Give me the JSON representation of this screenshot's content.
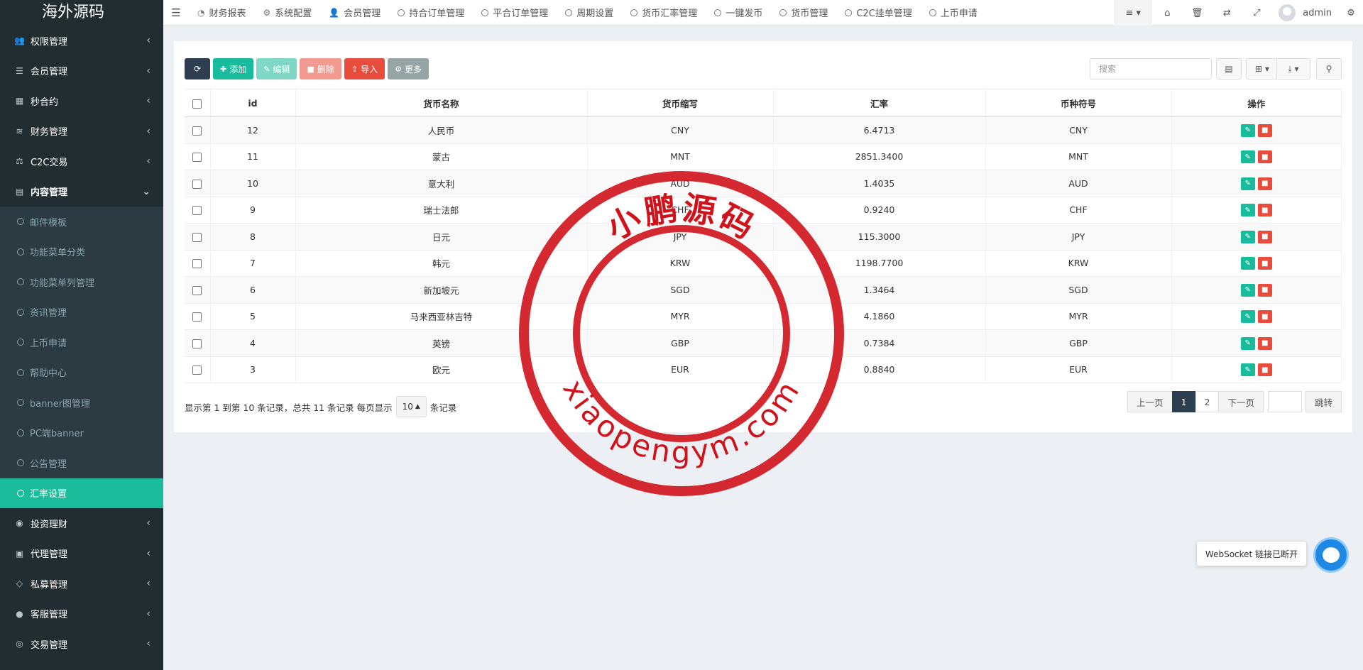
{
  "sidebar": {
    "logo": "海外源码",
    "items": [
      {
        "label": "权限管理",
        "icon": "users-icon",
        "ch": "‹"
      },
      {
        "label": "会员管理",
        "icon": "list-icon",
        "ch": "‹"
      },
      {
        "label": "秒合约",
        "icon": "calendar-icon",
        "ch": "‹"
      },
      {
        "label": "财务管理",
        "icon": "database-icon",
        "ch": "‹"
      },
      {
        "label": "C2C交易",
        "icon": "balance-icon",
        "ch": "‹"
      },
      {
        "label": "内容管理",
        "icon": "file-text-icon",
        "ch": "⌄"
      }
    ],
    "sub": [
      {
        "label": "邮件模板"
      },
      {
        "label": "功能菜单分类"
      },
      {
        "label": "功能菜单列管理"
      },
      {
        "label": "资讯管理"
      },
      {
        "label": "上币申请"
      },
      {
        "label": "帮助中心"
      },
      {
        "label": "banner图管理"
      },
      {
        "label": "PC端banner"
      },
      {
        "label": "公告管理"
      },
      {
        "label": "汇率设置"
      }
    ],
    "after": [
      {
        "label": "投资理财",
        "icon": "compass-icon",
        "ch": "‹"
      },
      {
        "label": "代理管理",
        "icon": "briefcase-icon",
        "ch": "‹"
      },
      {
        "label": "私募管理",
        "icon": "diamond-icon",
        "ch": "‹"
      },
      {
        "label": "客服管理",
        "icon": "comment-icon",
        "ch": "‹"
      },
      {
        "label": "交易管理",
        "icon": "eye-icon",
        "ch": "‹"
      }
    ]
  },
  "topbar": {
    "tabs": [
      {
        "label": "财务报表",
        "icon": "dashboard-icon"
      },
      {
        "label": "系统配置",
        "icon": "gear-icon"
      },
      {
        "label": "会员管理",
        "icon": "user-icon"
      },
      {
        "label": "持合订单管理",
        "icon": "circle-icon"
      },
      {
        "label": "平合订单管理",
        "icon": "circle-icon"
      },
      {
        "label": "周期设置",
        "icon": "circle-icon"
      },
      {
        "label": "货币汇率管理",
        "icon": "circle-icon"
      },
      {
        "label": "一键发币",
        "icon": "circle-icon"
      },
      {
        "label": "货币管理",
        "icon": "circle-icon"
      },
      {
        "label": "C2C挂单管理",
        "icon": "circle-icon"
      },
      {
        "label": "上币申请",
        "icon": "circle-icon"
      }
    ],
    "user": "admin"
  },
  "toolbar": {
    "add": "添加",
    "edit": "编辑",
    "delete": "删除",
    "import": "导入",
    "more": "更多"
  },
  "search": {
    "placeholder": "搜索"
  },
  "table": {
    "headers": [
      "id",
      "货币名称",
      "货币缩写",
      "汇率",
      "币种符号",
      "操作"
    ],
    "rows": [
      {
        "id": "12",
        "name": "人民币",
        "abbr": "CNY",
        "rate": "6.4713",
        "symbol": "CNY"
      },
      {
        "id": "11",
        "name": "蒙古",
        "abbr": "MNT",
        "rate": "2851.3400",
        "symbol": "MNT"
      },
      {
        "id": "10",
        "name": "意大利",
        "abbr": "AUD",
        "rate": "1.4035",
        "symbol": "AUD"
      },
      {
        "id": "9",
        "name": "瑞士法郎",
        "abbr": "CHF",
        "rate": "0.9240",
        "symbol": "CHF"
      },
      {
        "id": "8",
        "name": "日元",
        "abbr": "JPY",
        "rate": "115.3000",
        "symbol": "JPY"
      },
      {
        "id": "7",
        "name": "韩元",
        "abbr": "KRW",
        "rate": "1198.7700",
        "symbol": "KRW"
      },
      {
        "id": "6",
        "name": "新加坡元",
        "abbr": "SGD",
        "rate": "1.3464",
        "symbol": "SGD"
      },
      {
        "id": "5",
        "name": "马来西亚林吉特",
        "abbr": "MYR",
        "rate": "4.1860",
        "symbol": "MYR"
      },
      {
        "id": "4",
        "name": "英镑",
        "abbr": "GBP",
        "rate": "0.7384",
        "symbol": "GBP"
      },
      {
        "id": "3",
        "name": "欧元",
        "abbr": "EUR",
        "rate": "0.8840",
        "symbol": "EUR"
      }
    ]
  },
  "footer": {
    "info": "显示第 1 到第 10 条记录，总共 11 条记录 每页显示",
    "pagesize": "10",
    "unit": "条记录"
  },
  "pager": {
    "prev": "上一页",
    "p1": "1",
    "p2": "2",
    "next": "下一页",
    "jump": "跳转"
  },
  "websocket": {
    "text": "WebSocket 链接已断开"
  },
  "watermark": {
    "top": "小鹏源码",
    "bottom": "xiaopengym.com",
    "color": "#d0121b"
  }
}
